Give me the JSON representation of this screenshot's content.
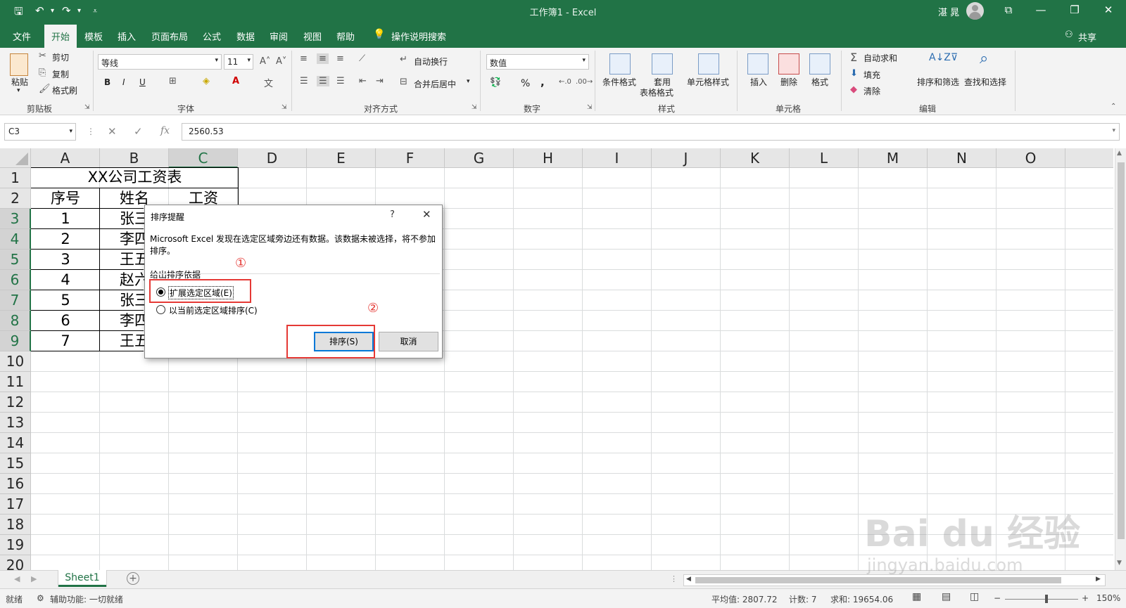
{
  "titlebar": {
    "title": "工作簿1  -  Excel",
    "user": "湛 晁",
    "quick_access": [
      "save",
      "undo",
      "redo",
      "customize"
    ]
  },
  "menu": {
    "tabs": [
      "文件",
      "开始",
      "模板",
      "插入",
      "页面布局",
      "公式",
      "数据",
      "审阅",
      "视图",
      "帮助"
    ],
    "active": "开始",
    "tell_me": "操作说明搜索",
    "share": "共享"
  },
  "ribbon": {
    "clipboard": {
      "paste": "粘贴",
      "cut": "剪切",
      "copy": "复制",
      "format_painter": "格式刷",
      "label": "剪贴板"
    },
    "font": {
      "font_name": "等线",
      "font_size": "11",
      "bold": "B",
      "italic": "I",
      "underline": "U",
      "label": "字体"
    },
    "alignment": {
      "wrap_text": "自动换行",
      "merge_center": "合并后居中",
      "label": "对齐方式"
    },
    "number": {
      "format": "数值",
      "percent": "%",
      "comma": ",",
      "label": "数字"
    },
    "styles": {
      "conditional": "条件格式",
      "table_line1": "套用",
      "table_line2": "表格格式",
      "cell_styles": "单元格样式",
      "label": "样式"
    },
    "cells": {
      "insert": "插入",
      "delete": "删除",
      "format": "格式",
      "label": "单元格"
    },
    "editing": {
      "autosum": "自动求和",
      "fill": "填充",
      "clear": "清除",
      "sort_filter": "排序和筛选",
      "find_select": "查找和选择",
      "label": "编辑"
    }
  },
  "formula_bar": {
    "name_box": "C3",
    "value": "2560.53",
    "fx": "fx"
  },
  "grid": {
    "columns": [
      "A",
      "B",
      "C",
      "D",
      "E",
      "F",
      "G",
      "H",
      "I",
      "J",
      "K",
      "L",
      "M",
      "N",
      "O"
    ],
    "rows": [
      "1",
      "2",
      "3",
      "4",
      "5",
      "6",
      "7",
      "8",
      "9",
      "10",
      "11",
      "12",
      "13",
      "14",
      "15",
      "16",
      "17",
      "18",
      "19",
      "20"
    ],
    "selected_column": "C",
    "selected_rows": [
      "3",
      "4",
      "5",
      "6",
      "7",
      "8",
      "9"
    ],
    "table_title": "XX公司工资表",
    "headers": [
      "序号",
      "姓名",
      "工资"
    ],
    "rows_data": [
      [
        "1",
        "张三"
      ],
      [
        "2",
        "李四"
      ],
      [
        "3",
        "王五"
      ],
      [
        "4",
        "赵六"
      ],
      [
        "5",
        "张三"
      ],
      [
        "6",
        "李四"
      ],
      [
        "7",
        "王五"
      ]
    ]
  },
  "dialog": {
    "title": "排序提醒",
    "help": "?",
    "close": "✕",
    "message": "Microsoft Excel 发现在选定区域旁边还有数据。该数据未被选择，将不参加排序。",
    "section": "给出排序依据",
    "option_expand": "扩展选定区域(E)",
    "option_current": "以当前选定区域排序(C)",
    "selected_option": "expand",
    "sort_button": "排序(S)",
    "cancel_button": "取消"
  },
  "annotations": {
    "one": "①",
    "two": "②",
    "color": "#e53935"
  },
  "sheets": {
    "tabs": [
      "Sheet1"
    ],
    "active": "Sheet1"
  },
  "status": {
    "ready": "就绪",
    "accessibility": "辅助功能: 一切就绪",
    "average": "平均值: 2807.72",
    "count": "计数: 7",
    "sum": "求和: 19654.06",
    "zoom": "150%"
  },
  "watermark": {
    "brand": "Bai du 经验",
    "url": "jingyan.baidu.com"
  },
  "colors": {
    "excel_green": "#217346",
    "ribbon_bg": "#f3f3f3",
    "grid_line": "#dadcdd",
    "focus_blue": "#0078d7"
  }
}
